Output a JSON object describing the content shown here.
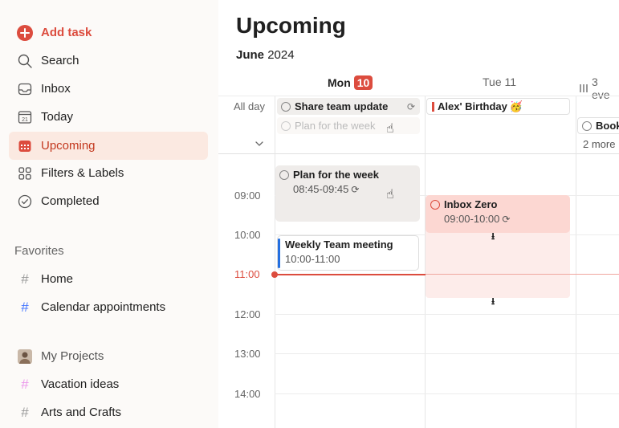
{
  "sidebar": {
    "add_task": "Add task",
    "nav": [
      {
        "label": "Search",
        "icon": "search-icon"
      },
      {
        "label": "Inbox",
        "icon": "inbox-icon"
      },
      {
        "label": "Today",
        "icon": "calendar-day-icon",
        "day": "21"
      },
      {
        "label": "Upcoming",
        "icon": "calendar-grid-icon"
      },
      {
        "label": "Filters & Labels",
        "icon": "grid-icon"
      },
      {
        "label": "Completed",
        "icon": "check-circle-icon"
      }
    ],
    "favorites_title": "Favorites",
    "favorites": [
      {
        "label": "Home",
        "color": "#999999"
      },
      {
        "label": "Calendar appointments",
        "color": "#4073ff"
      }
    ],
    "projects_title": "My Projects",
    "projects": [
      {
        "label": "Vacation ideas",
        "color": "#eb96eb"
      },
      {
        "label": "Arts and Crafts",
        "color": "#999999"
      }
    ]
  },
  "main": {
    "title": "Upcoming",
    "month": "June",
    "year": "2024",
    "days": [
      {
        "label": "Mon",
        "num": "10"
      },
      {
        "label": "Tue 11"
      },
      {
        "label": "3 eve"
      }
    ],
    "allday_label": "All day",
    "allday_events": {
      "mon_1": "Share team update",
      "mon_2": "Plan for the week",
      "tue_1": "Alex' Birthday",
      "tue_emoji": "🥳",
      "wed_1": "Book",
      "wed_more": "2 more"
    },
    "times": [
      "09:00",
      "10:00",
      "11:00",
      "12:00",
      "13:00",
      "14:00"
    ],
    "events": {
      "plan": {
        "title": "Plan for the week",
        "time": "08:45-09:45"
      },
      "weekly": {
        "title": "Weekly Team meeting",
        "time": "10:00-11:00"
      },
      "inbox": {
        "title": "Inbox Zero",
        "time": "09:00-10:00"
      }
    },
    "colors": {
      "accent": "#dc4c3e",
      "active_bg": "#fbe9e1",
      "weekly_bar": "#246fe0"
    }
  }
}
